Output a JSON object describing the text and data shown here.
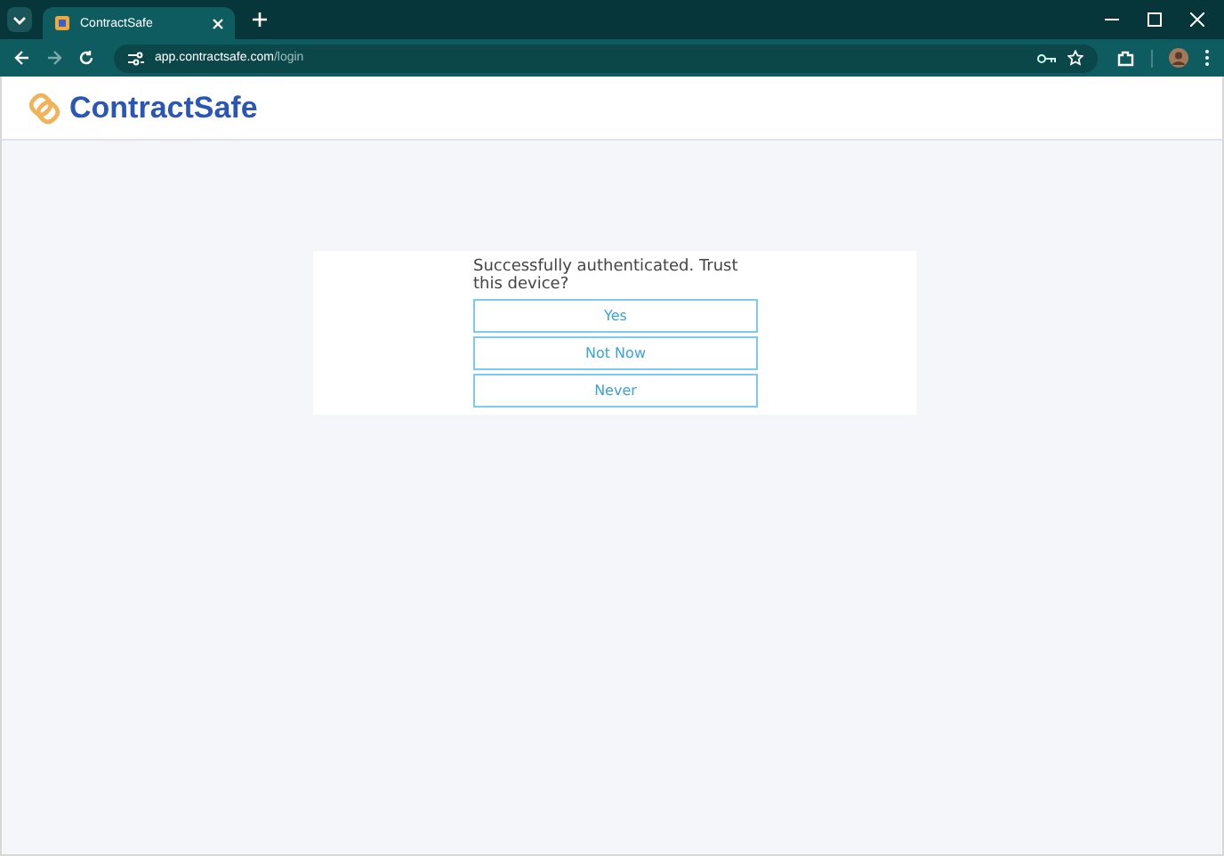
{
  "browser": {
    "tab": {
      "title": "ContractSafe",
      "selected": true
    },
    "url": {
      "host": "app.contractsafe.com",
      "path": "/login"
    }
  },
  "header": {
    "logo_text": "ContractSafe"
  },
  "dialog": {
    "message": "Successfully authenticated. Trust this device?",
    "buttons": [
      "Yes",
      "Not Now",
      "Never"
    ]
  }
}
